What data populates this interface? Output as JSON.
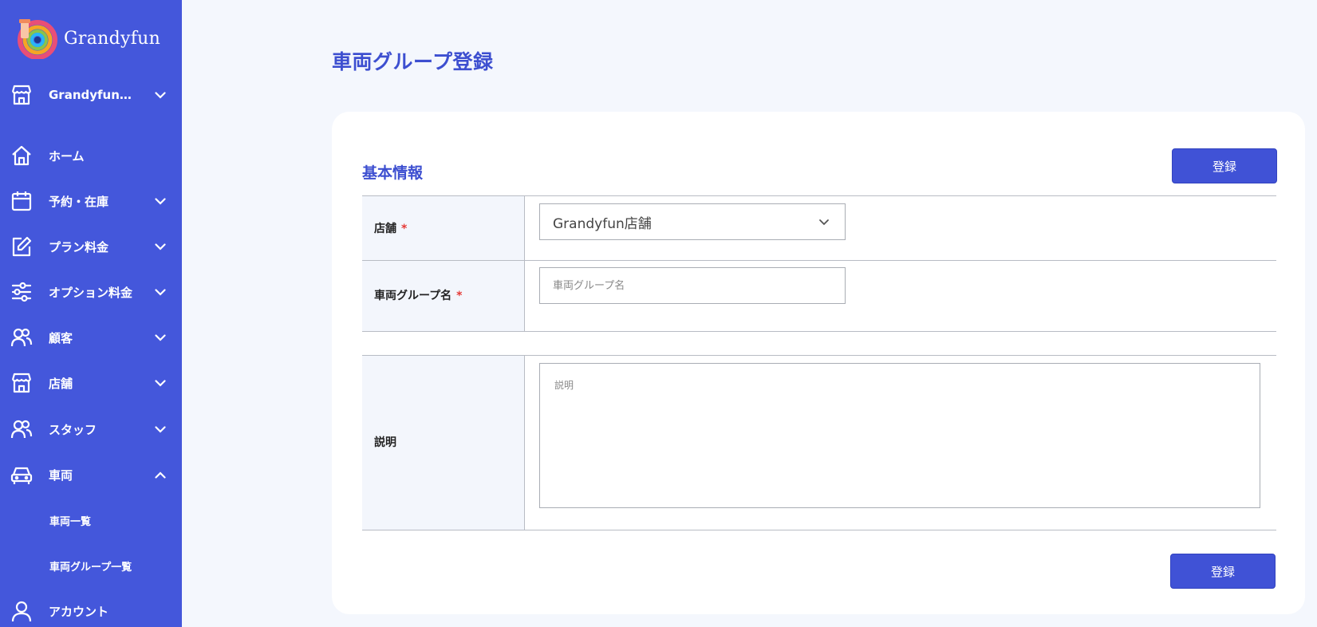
{
  "brand": {
    "name": "Grandyfun"
  },
  "sidebar": {
    "store_selector": {
      "label": "Grandyfun…",
      "icon": "store-icon"
    },
    "items": [
      {
        "label": "ホーム",
        "icon": "home-icon",
        "expandable": false
      },
      {
        "label": "予約・在庫",
        "icon": "calendar-icon",
        "expandable": true,
        "expanded": false
      },
      {
        "label": "プラン料金",
        "icon": "edit-icon",
        "expandable": true,
        "expanded": false
      },
      {
        "label": "オプション料金",
        "icon": "sliders-icon",
        "expandable": true,
        "expanded": false
      },
      {
        "label": "顧客",
        "icon": "users-icon",
        "expandable": true,
        "expanded": false
      },
      {
        "label": "店舗",
        "icon": "store-icon",
        "expandable": true,
        "expanded": false
      },
      {
        "label": "スタッフ",
        "icon": "users-icon",
        "expandable": true,
        "expanded": false
      },
      {
        "label": "車両",
        "icon": "car-icon",
        "expandable": true,
        "expanded": true
      },
      {
        "label": "アカウント",
        "icon": "user-icon",
        "expandable": false
      }
    ],
    "vehicle_subitems": [
      {
        "label": "車両一覧"
      },
      {
        "label": "車両グループ一覧"
      }
    ]
  },
  "main": {
    "page_title": "車両グループ登録",
    "section_title": "基本情報",
    "register_button": "登録",
    "form": {
      "store": {
        "label": "店舗",
        "required_mark": "*",
        "selected_value": "Grandyfun店舗"
      },
      "group_name": {
        "label": "車両グループ名",
        "required_mark": "*",
        "value": "",
        "placeholder": "車両グループ名"
      },
      "description": {
        "label": "説明",
        "value": "",
        "placeholder": "説明"
      }
    }
  },
  "colors": {
    "sidebar_bg": "#4457db",
    "accent": "#3d4fd0",
    "button": "#4052d6",
    "required": "#e53935",
    "page_bg": "#f4f7fd"
  }
}
